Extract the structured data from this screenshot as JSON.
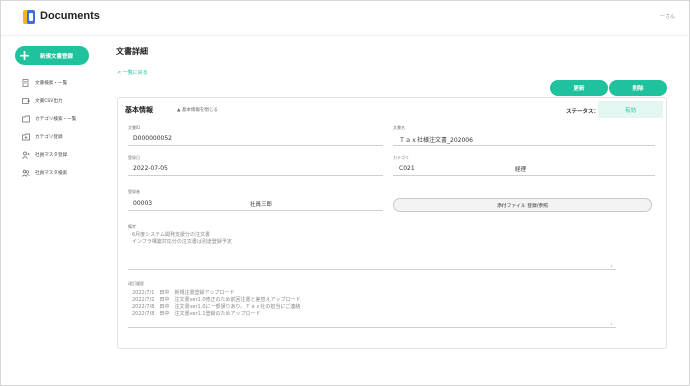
{
  "header": {
    "app_title": "Documents",
    "user": "ーさん"
  },
  "sidebar": {
    "new_button": "新規文書登録",
    "items": [
      {
        "label": "文書検索・一覧",
        "icon": "document-search-icon"
      },
      {
        "label": "文書CSV出力",
        "icon": "csv-export-icon"
      },
      {
        "label": "カテゴリ検索・一覧",
        "icon": "category-search-icon"
      },
      {
        "label": "カテゴリ登録",
        "icon": "category-add-icon"
      },
      {
        "label": "社員マスタ登録",
        "icon": "person-add-icon"
      },
      {
        "label": "社員マスタ検索",
        "icon": "people-search-icon"
      }
    ]
  },
  "main": {
    "title": "文書詳細",
    "back_link": "< 一覧に戻る",
    "update_button": "更新",
    "delete_button": "削除",
    "section_title": "基本情報",
    "collapse_toggle": "▲ 基本情報を閉じる",
    "status_label": "ステータス：",
    "status_value": "有効",
    "fields": {
      "doc_id": {
        "label": "文書ID",
        "value": "D000000052"
      },
      "doc_name": {
        "label": "文書名",
        "value": "Ｔａｘ社様注文書_202006"
      },
      "reg_date": {
        "label": "登録日",
        "value": "2022-07-05"
      },
      "category": {
        "label": "カテゴリ",
        "code": "C021",
        "name": "経理"
      },
      "registrant": {
        "label": "登録者",
        "code": "00003",
        "name": "社員三郎"
      }
    },
    "attach_button": "添付ファイル 登録/参照",
    "remarks": {
      "label": "備考",
      "lines": [
        "6月度システム開発支援分の注文書",
        "インフラ構築対応分の注文書は別途登録予定"
      ]
    },
    "history": {
      "label": "改訂履歴",
      "lines": [
        "2022/7/1　田中　新規注書登録アップロード",
        "2022/7/2　田中　注文書ver1.0修正のため前回注書と差替えアップロード",
        "2022/7/8　田中　注文書ver1.0に一部誤りあり。Ｔａｘ社の担当にご連絡",
        "2022/7/8　田中　注文書ver1.1登録のためアップロード"
      ]
    }
  },
  "colors": {
    "accent": "#1fc29c",
    "status_bg": "#e4f6f1"
  }
}
